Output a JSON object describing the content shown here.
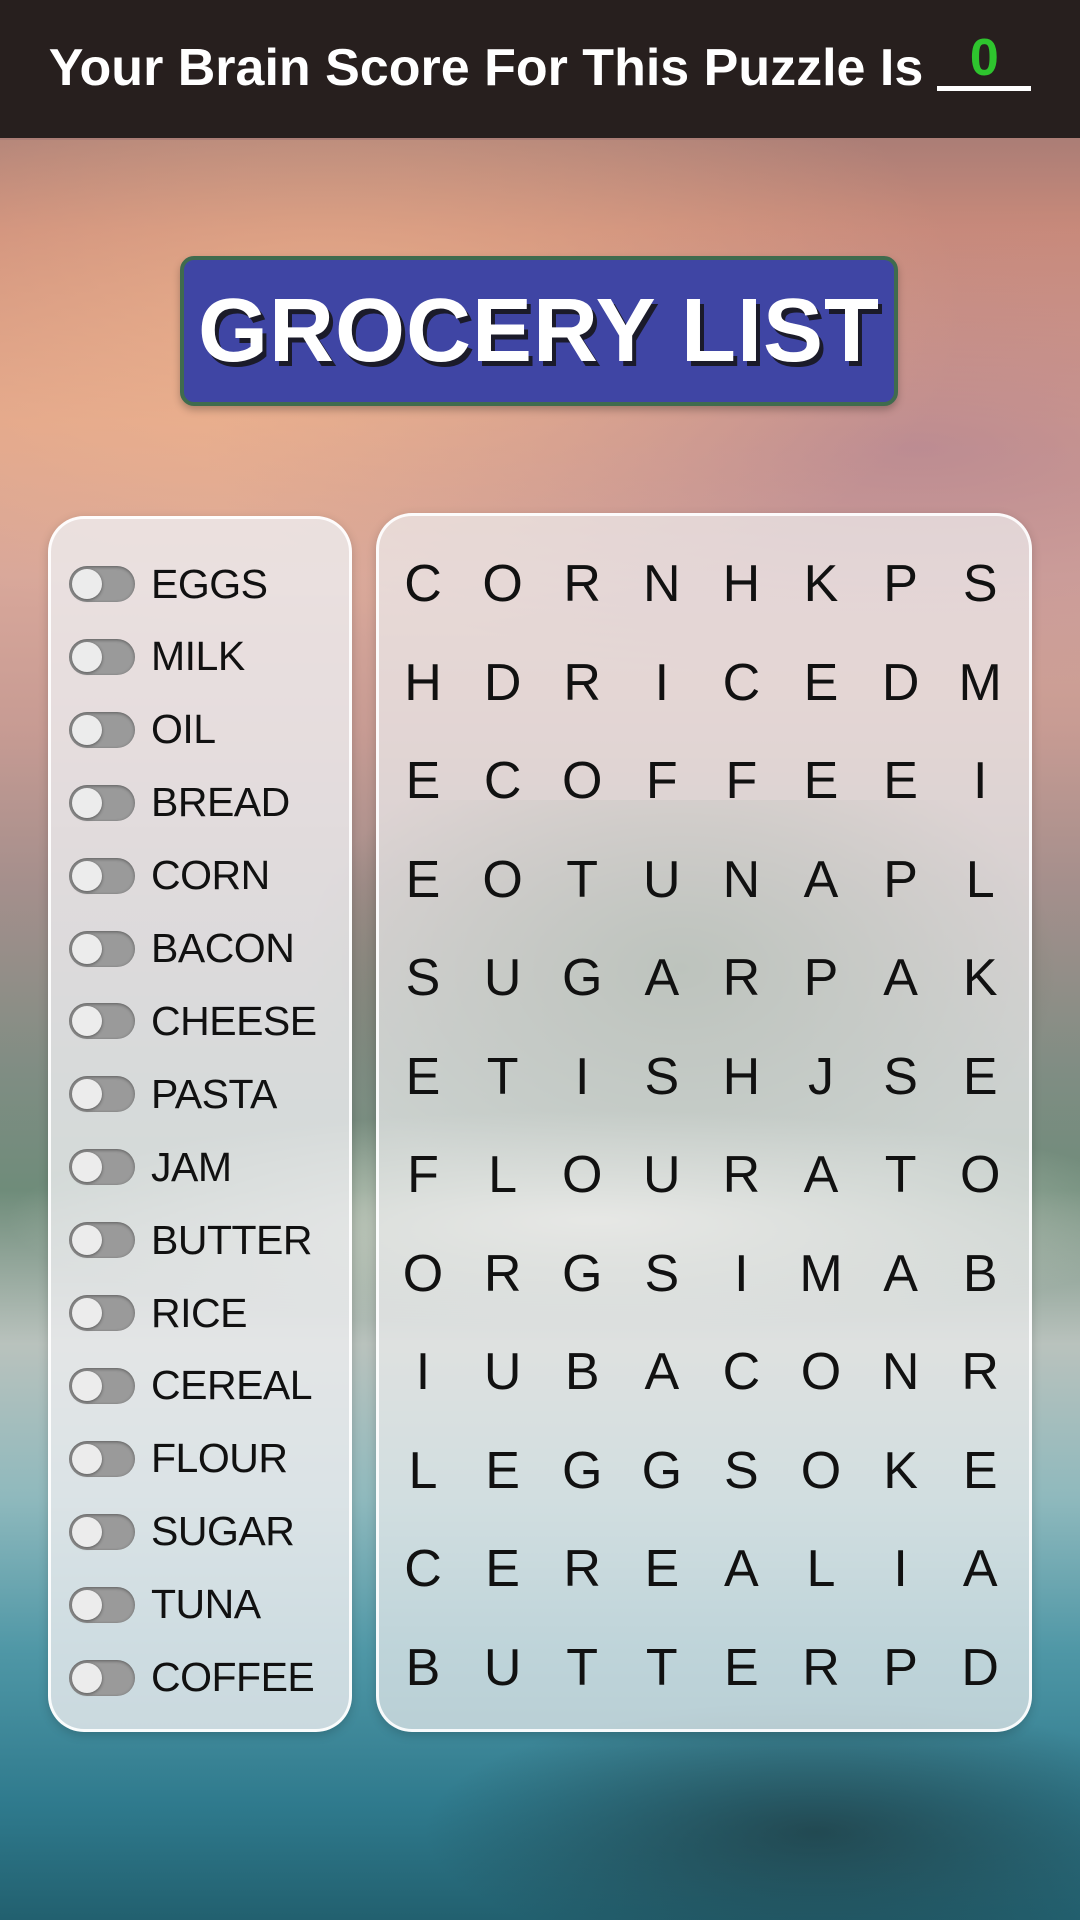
{
  "header": {
    "score_label": "Your Brain Score For This Puzzle Is",
    "score_value": "0",
    "score_color": "#2ec42e"
  },
  "puzzle": {
    "title": "GROCERY LIST",
    "banner_color": "#3f45a4"
  },
  "word_list": [
    {
      "word": "EGGS",
      "found": false
    },
    {
      "word": "MILK",
      "found": false
    },
    {
      "word": "OIL",
      "found": false
    },
    {
      "word": "BREAD",
      "found": false
    },
    {
      "word": "CORN",
      "found": false
    },
    {
      "word": "BACON",
      "found": false
    },
    {
      "word": "CHEESE",
      "found": false
    },
    {
      "word": "PASTA",
      "found": false
    },
    {
      "word": "JAM",
      "found": false
    },
    {
      "word": "BUTTER",
      "found": false
    },
    {
      "word": "RICE",
      "found": false
    },
    {
      "word": "CEREAL",
      "found": false
    },
    {
      "word": "FLOUR",
      "found": false
    },
    {
      "word": "SUGAR",
      "found": false
    },
    {
      "word": "TUNA",
      "found": false
    },
    {
      "word": "COFFEE",
      "found": false
    }
  ],
  "grid": [
    [
      "C",
      "O",
      "R",
      "N",
      "H",
      "K",
      "P",
      "S"
    ],
    [
      "H",
      "D",
      "R",
      "I",
      "C",
      "E",
      "D",
      "M"
    ],
    [
      "E",
      "C",
      "O",
      "F",
      "F",
      "E",
      "E",
      "I"
    ],
    [
      "E",
      "O",
      "T",
      "U",
      "N",
      "A",
      "P",
      "L"
    ],
    [
      "S",
      "U",
      "G",
      "A",
      "R",
      "P",
      "A",
      "K"
    ],
    [
      "E",
      "T",
      "I",
      "S",
      "H",
      "J",
      "S",
      "E"
    ],
    [
      "F",
      "L",
      "O",
      "U",
      "R",
      "A",
      "T",
      "O"
    ],
    [
      "O",
      "R",
      "G",
      "S",
      "I",
      "M",
      "A",
      "B"
    ],
    [
      "I",
      "U",
      "B",
      "A",
      "C",
      "O",
      "N",
      "R"
    ],
    [
      "L",
      "E",
      "G",
      "G",
      "S",
      "O",
      "K",
      "E"
    ],
    [
      "C",
      "E",
      "R",
      "E",
      "A",
      "L",
      "I",
      "A"
    ],
    [
      "B",
      "U",
      "T",
      "T",
      "E",
      "R",
      "P",
      "D"
    ]
  ]
}
